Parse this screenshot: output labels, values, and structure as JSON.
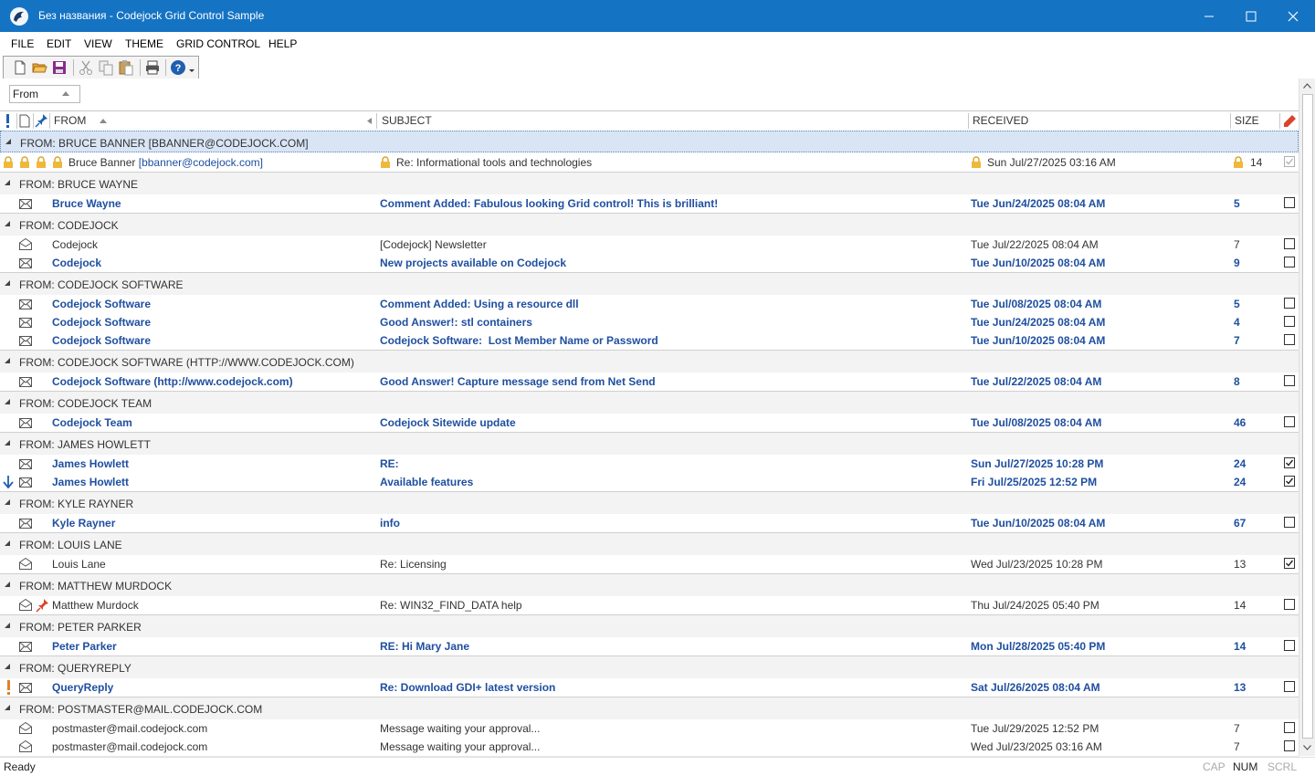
{
  "window": {
    "title": "Без названия - Codejock Grid Control Sample"
  },
  "menu": [
    "FILE",
    "EDIT",
    "VIEW",
    "THEME",
    "GRID CONTROL",
    "HELP"
  ],
  "groupby": {
    "chip": "From"
  },
  "columns": {
    "from": "FROM",
    "subject": "SUBJECT",
    "received": "RECEIVED",
    "size": "SIZE"
  },
  "groups": [
    {
      "label": "FROM: BRUCE BANNER [BBANNER@CODEJOCK.COM]"
    },
    {
      "label": "FROM: BRUCE WAYNE"
    },
    {
      "label": "FROM: CODEJOCK"
    },
    {
      "label": "FROM: CODEJOCK SOFTWARE"
    },
    {
      "label": "FROM: CODEJOCK SOFTWARE (HTTP://WWW.CODEJOCK.COM)"
    },
    {
      "label": "FROM: CODEJOCK TEAM"
    },
    {
      "label": "FROM: JAMES HOWLETT"
    },
    {
      "label": "FROM: KYLE RAYNER"
    },
    {
      "label": "FROM: LOUIS LANE"
    },
    {
      "label": "FROM: MATTHEW MURDOCK"
    },
    {
      "label": "FROM: PETER PARKER"
    },
    {
      "label": "FROM: QUERYREPLY"
    },
    {
      "label": "FROM: POSTMASTER@MAIL.CODEJOCK.COM"
    }
  ],
  "rows": [
    {
      "from": "Bruce Banner",
      "from_link": "[bbanner@codejock.com]",
      "subject": "Re: Informational tools and technologies",
      "received": "Sun Jul/27/2025 03:16 AM",
      "size": "14",
      "checked": true
    },
    {
      "from": "Bruce Wayne",
      "subject": "Comment Added: Fabulous looking Grid control! This is brilliant!",
      "received": "Tue Jun/24/2025 08:04 AM",
      "size": "5",
      "checked": false
    },
    {
      "from": "Codejock",
      "subject": "[Codejock] Newsletter",
      "received": "Tue Jul/22/2025 08:04 AM",
      "size": "7",
      "checked": false
    },
    {
      "from": "Codejock",
      "subject": "New projects available on Codejock",
      "received": "Tue Jun/10/2025 08:04 AM",
      "size": "9",
      "checked": false
    },
    {
      "from": "Codejock Software",
      "subject": "Comment Added: Using a resource dll",
      "received": "Tue Jul/08/2025 08:04 AM",
      "size": "5",
      "checked": false
    },
    {
      "from": "Codejock Software",
      "subject": "Good Answer!: stl containers",
      "received": "Tue Jun/24/2025 08:04 AM",
      "size": "4",
      "checked": false
    },
    {
      "from": "Codejock Software",
      "subject": "Codejock Software:  Lost Member Name or Password",
      "received": "Tue Jun/10/2025 08:04 AM",
      "size": "7",
      "checked": false
    },
    {
      "from": "Codejock Software (http://www.codejock.com)",
      "subject": "Good Answer! Capture message send from Net Send",
      "received": "Tue Jul/22/2025 08:04 AM",
      "size": "8",
      "checked": false
    },
    {
      "from": "Codejock Team",
      "subject": "Codejock Sitewide update",
      "received": "Tue Jul/08/2025 08:04 AM",
      "size": "46",
      "checked": false
    },
    {
      "from": "James Howlett",
      "subject": "RE:",
      "received": "Sun Jul/27/2025 10:28 PM",
      "size": "24",
      "checked": true
    },
    {
      "from": "James Howlett",
      "subject": "Available features",
      "received": "Fri Jul/25/2025 12:52 PM",
      "size": "24",
      "checked": true
    },
    {
      "from": "Kyle Rayner",
      "subject": "info",
      "received": "Tue Jun/10/2025 08:04 AM",
      "size": "67",
      "checked": false
    },
    {
      "from": "Louis Lane",
      "subject": "Re: Licensing",
      "received": "Wed Jul/23/2025 10:28 PM",
      "size": "13",
      "checked": true
    },
    {
      "from": "Matthew Murdock",
      "subject": "Re: WIN32_FIND_DATA help",
      "received": "Thu Jul/24/2025 05:40 PM",
      "size": "14",
      "checked": false
    },
    {
      "from": "Peter Parker",
      "subject": "RE: Hi Mary Jane",
      "received": "Mon Jul/28/2025 05:40 PM",
      "size": "14",
      "checked": false
    },
    {
      "from": "QueryReply",
      "subject": "Re: Download GDI+ latest version",
      "received": "Sat Jul/26/2025 08:04 AM",
      "size": "13",
      "checked": false
    },
    {
      "from": "postmaster@mail.codejock.com",
      "subject": "Message waiting your approval...",
      "received": "Tue Jul/29/2025 12:52 PM",
      "size": "7",
      "checked": false
    },
    {
      "from": "postmaster@mail.codejock.com",
      "subject": "Message waiting your approval...",
      "received": "Wed Jul/23/2025 03:16 AM",
      "size": "7",
      "checked": false
    }
  ],
  "status": {
    "left": "Ready",
    "cap": "CAP",
    "num": "NUM",
    "scrl": "SCRL"
  },
  "colors": {
    "titlebar": "#1573c4",
    "unread": "#1f4fa0",
    "group_bg": "#f3f3f3"
  }
}
